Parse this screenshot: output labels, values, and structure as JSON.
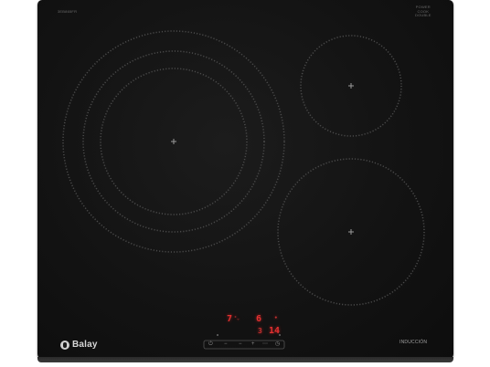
{
  "product": {
    "brand": "Balay",
    "model_code": "3EB865FR",
    "badge_line1": "POWER",
    "badge_line2": "COOK",
    "badge_line3": "DOUBLE",
    "induction_label": "INDUCCIÓN"
  },
  "displays": {
    "left_level": "7",
    "left_marker": "°⌄",
    "right_level": "6",
    "timer_minutes": "14",
    "timer_zone": "3",
    "small_dot": "•"
  },
  "controls": {
    "power_icon": "power-icon",
    "minus_label": "−",
    "plus_label": "+",
    "timer_icon": "timer-icon",
    "dots_label": "⋯"
  },
  "colors": {
    "glass": "#141414",
    "zone_ring": "#4a4a4a",
    "display_red": "#e23030"
  }
}
